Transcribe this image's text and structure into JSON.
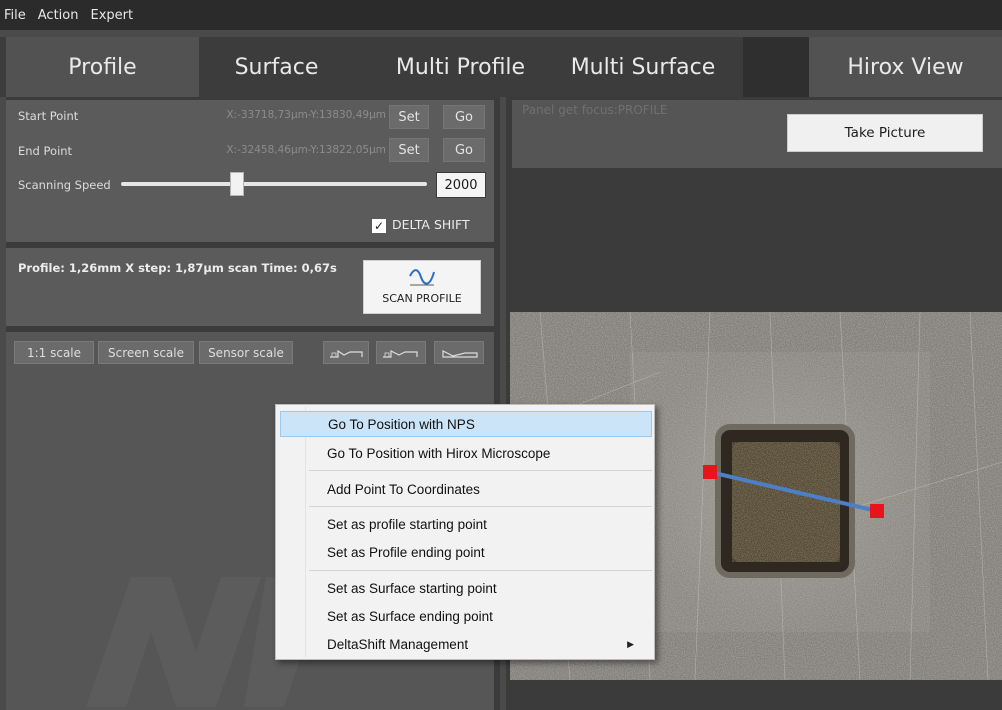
{
  "menu": {
    "items": [
      "File",
      "Action",
      "Expert"
    ]
  },
  "tabs": [
    "Profile",
    "Surface",
    "Multi Profile",
    "Multi Surface",
    "Hirox View"
  ],
  "profile_panel": {
    "start_point": {
      "label": "Start Point",
      "coords": "X:-33718,73µm-Y:13830,49µm",
      "set": "Set",
      "go": "Go"
    },
    "end_point": {
      "label": "End Point",
      "coords": "X:-32458,46µm-Y:13822,05µm",
      "set": "Set",
      "go": "Go"
    },
    "scanning_speed": {
      "label": "Scanning Speed",
      "value": "2000",
      "slider_fraction": 0.38
    },
    "delta_shift": {
      "label": "DELTA SHIFT",
      "checked": true
    }
  },
  "scan_panel": {
    "info": "Profile: 1,26mm  X step: 1,87µm scan Time: 0,67s",
    "scan_button": "SCAN PROFILE"
  },
  "scale_bar": {
    "one_to_one": "1:1 scale",
    "screen": "Screen scale",
    "sensor": "Sensor scale"
  },
  "hirox": {
    "status": "Panel get focus:PROFILE",
    "take_picture": "Take Picture"
  },
  "context_menu": {
    "items": [
      "Go To Position with NPS",
      "Go To Position with Hirox Microscope",
      "Add Point To Coordinates",
      "Set as profile starting point",
      "Set as Profile ending point",
      "Set as Surface starting point",
      "Set as Surface ending point",
      "DeltaShift Management"
    ],
    "highlighted": "Go To Position with NPS"
  },
  "colors": {
    "marker": "#e8131b",
    "profile_line": "#4c7fc6",
    "menu_highlight": "#cce4f7"
  }
}
